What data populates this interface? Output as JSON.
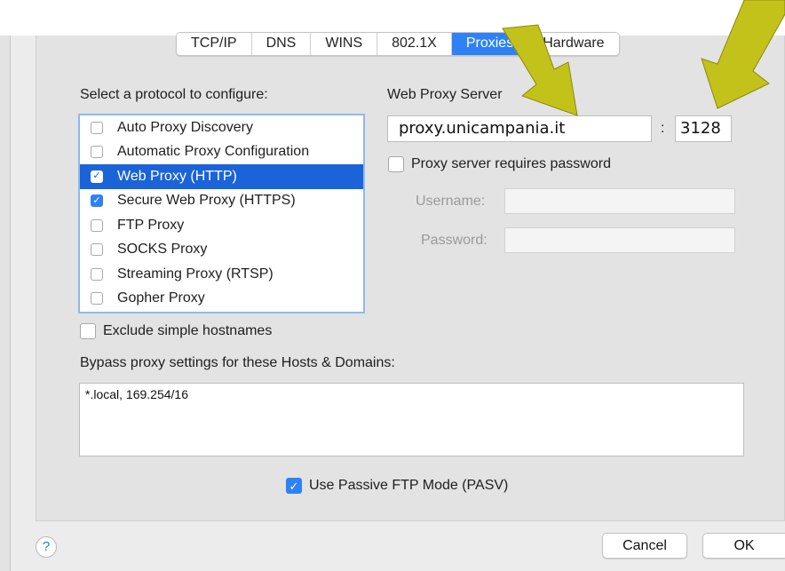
{
  "tabs": [
    {
      "label": "TCP/IP",
      "selected": false
    },
    {
      "label": "DNS",
      "selected": false
    },
    {
      "label": "WINS",
      "selected": false
    },
    {
      "label": "802.1X",
      "selected": false
    },
    {
      "label": "Proxies",
      "selected": true
    },
    {
      "label": "Hardware",
      "selected": false
    }
  ],
  "protocols": {
    "heading": "Select a protocol to configure:",
    "items": [
      {
        "label": "Auto Proxy Discovery",
        "checked": false,
        "selected": false
      },
      {
        "label": "Automatic Proxy Configuration",
        "checked": false,
        "selected": false
      },
      {
        "label": "Web Proxy (HTTP)",
        "checked": true,
        "selected": true
      },
      {
        "label": "Secure Web Proxy (HTTPS)",
        "checked": true,
        "selected": false
      },
      {
        "label": "FTP Proxy",
        "checked": false,
        "selected": false
      },
      {
        "label": "SOCKS Proxy",
        "checked": false,
        "selected": false
      },
      {
        "label": "Streaming Proxy (RTSP)",
        "checked": false,
        "selected": false
      },
      {
        "label": "Gopher Proxy",
        "checked": false,
        "selected": false
      }
    ]
  },
  "server": {
    "heading": "Web Proxy Server",
    "host": "proxy.unicampania.it",
    "separator": ":",
    "port": "3128",
    "requires_password_label": "Proxy server requires password",
    "requires_password": false,
    "username_label": "Username:",
    "username": "",
    "password_label": "Password:",
    "password": ""
  },
  "exclude_simple_label": "Exclude simple hostnames",
  "exclude_simple": false,
  "bypass": {
    "label": "Bypass proxy settings for these Hosts & Domains:",
    "value": "*.local, 169.254/16"
  },
  "passive_ftp_label": "Use Passive FTP Mode (PASV)",
  "passive_ftp": true,
  "buttons": {
    "help": "?",
    "cancel": "Cancel",
    "ok": "OK"
  },
  "colors": {
    "accent": "#2f82f5",
    "selection": "#1a63d8",
    "annotation_arrow": "#c2c21a"
  },
  "icons": {
    "help": "question-mark-icon",
    "check": "checkmark-icon",
    "arrow": "annotation-arrow-icon"
  }
}
